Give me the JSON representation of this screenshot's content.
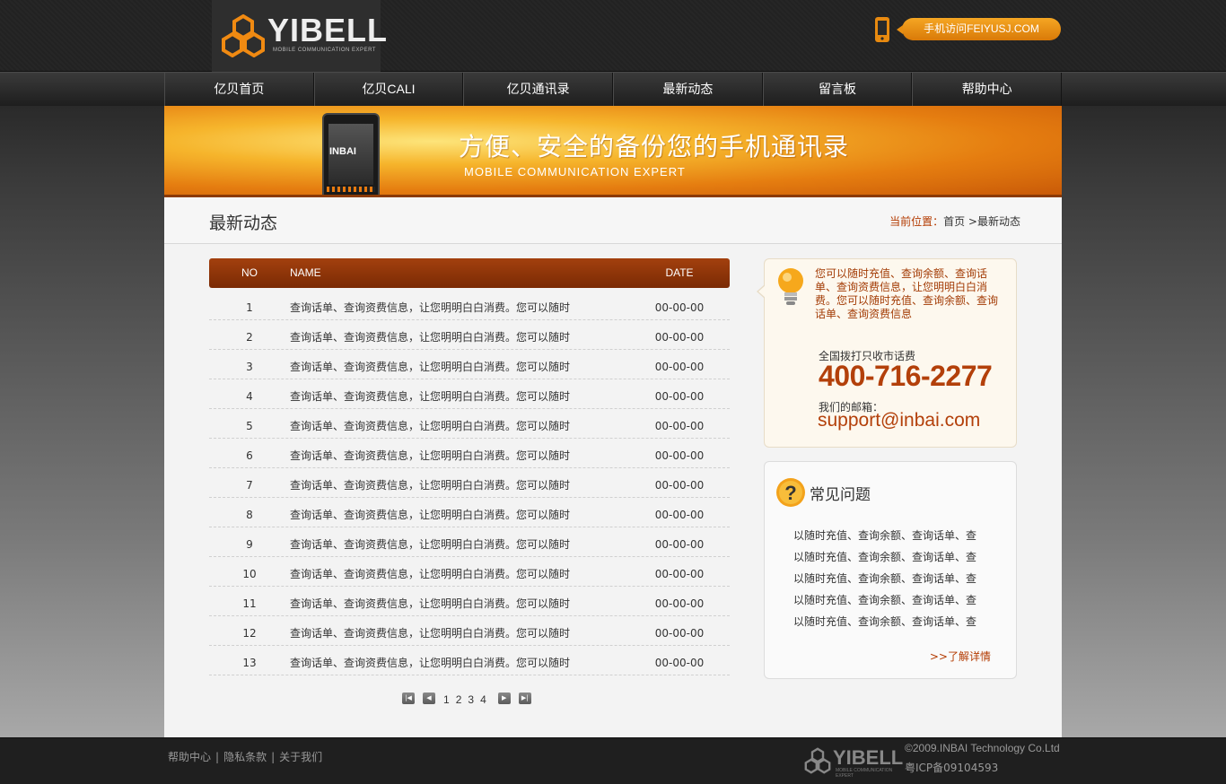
{
  "header": {
    "logo_text": "YIBELL",
    "logo_sub": "MOBILE COMMUNICATION EXPERT",
    "mobile_link": "手机访问FEIYUSJ.COM"
  },
  "nav": {
    "items": [
      {
        "label": "亿贝首页"
      },
      {
        "label": "亿贝CALI"
      },
      {
        "label": "亿贝通讯录"
      },
      {
        "label": "最新动态"
      },
      {
        "label": "留言板"
      },
      {
        "label": "帮助中心"
      }
    ]
  },
  "banner": {
    "phone_brand": "INBAI",
    "title": "方便、安全的备份您的手机通讯录",
    "subtitle": "MOBILE COMMUNICATION EXPERT"
  },
  "content": {
    "page_title": "最新动态",
    "breadcrumb": {
      "label": "当前位置：",
      "home": "首页",
      "sep": " >",
      "current": "最新动态"
    }
  },
  "table": {
    "headers": {
      "no": "NO",
      "name": "NAME",
      "date": "DATE"
    },
    "rows": [
      {
        "no": "1",
        "name": "查询话单、查询资费信息，让您明明白白消费。您可以随时",
        "date": "00-00-00"
      },
      {
        "no": "2",
        "name": "查询话单、查询资费信息，让您明明白白消费。您可以随时",
        "date": "00-00-00"
      },
      {
        "no": "3",
        "name": "查询话单、查询资费信息，让您明明白白消费。您可以随时",
        "date": "00-00-00"
      },
      {
        "no": "4",
        "name": "查询话单、查询资费信息，让您明明白白消费。您可以随时",
        "date": "00-00-00"
      },
      {
        "no": "5",
        "name": "查询话单、查询资费信息，让您明明白白消费。您可以随时",
        "date": "00-00-00"
      },
      {
        "no": "6",
        "name": "查询话单、查询资费信息，让您明明白白消费。您可以随时",
        "date": "00-00-00"
      },
      {
        "no": "7",
        "name": "查询话单、查询资费信息，让您明明白白消费。您可以随时",
        "date": "00-00-00"
      },
      {
        "no": "8",
        "name": "查询话单、查询资费信息，让您明明白白消费。您可以随时",
        "date": "00-00-00"
      },
      {
        "no": "9",
        "name": "查询话单、查询资费信息，让您明明白白消费。您可以随时",
        "date": "00-00-00"
      },
      {
        "no": "10",
        "name": "查询话单、查询资费信息，让您明明白白消费。您可以随时",
        "date": "00-00-00"
      },
      {
        "no": "11",
        "name": "查询话单、查询资费信息，让您明明白白消费。您可以随时",
        "date": "00-00-00"
      },
      {
        "no": "12",
        "name": "查询话单、查询资费信息，让您明明白白消费。您可以随时",
        "date": "00-00-00"
      },
      {
        "no": "13",
        "name": "查询话单、查询资费信息，让您明明白白消费。您可以随时",
        "date": "00-00-00"
      }
    ]
  },
  "pager": {
    "pages": [
      "1",
      "2",
      "3",
      "4"
    ]
  },
  "sidebar": {
    "contact": {
      "text": "您可以随时充值、查询余额、查询话单、查询资费信息，让您明明白白消费。您可以随时充值、查询余额、查询话单、查询资费信息",
      "hotline_label": "全国拨打只收市话费",
      "hotline": "400-716-2277",
      "email_label": "我们的邮箱：",
      "email": "support@inbai.com"
    },
    "faq": {
      "title": "常见问题",
      "items": [
        "以随时充值、查询余额、查询话单、查",
        "以随时充值、查询余额、查询话单、查",
        "以随时充值、查询余额、查询话单、查",
        "以随时充值、查询余额、查询话单、查",
        "以随时充值、查询余额、查询话单、查"
      ],
      "more": ">>了解详情"
    }
  },
  "footer": {
    "links": [
      "帮助中心",
      "隐私条款",
      "关于我们"
    ],
    "separator": "|",
    "logo_text": "YIBELL",
    "logo_sub": "MOBILE COMMUNICATION EXPERT",
    "copyright": "©2009.INBAI Technology Co.Ltd",
    "icp": "粤ICP备09104593"
  },
  "colors": {
    "accent": "#f39c1a",
    "header_row": "#8a3208",
    "link_red": "#b33a00"
  }
}
